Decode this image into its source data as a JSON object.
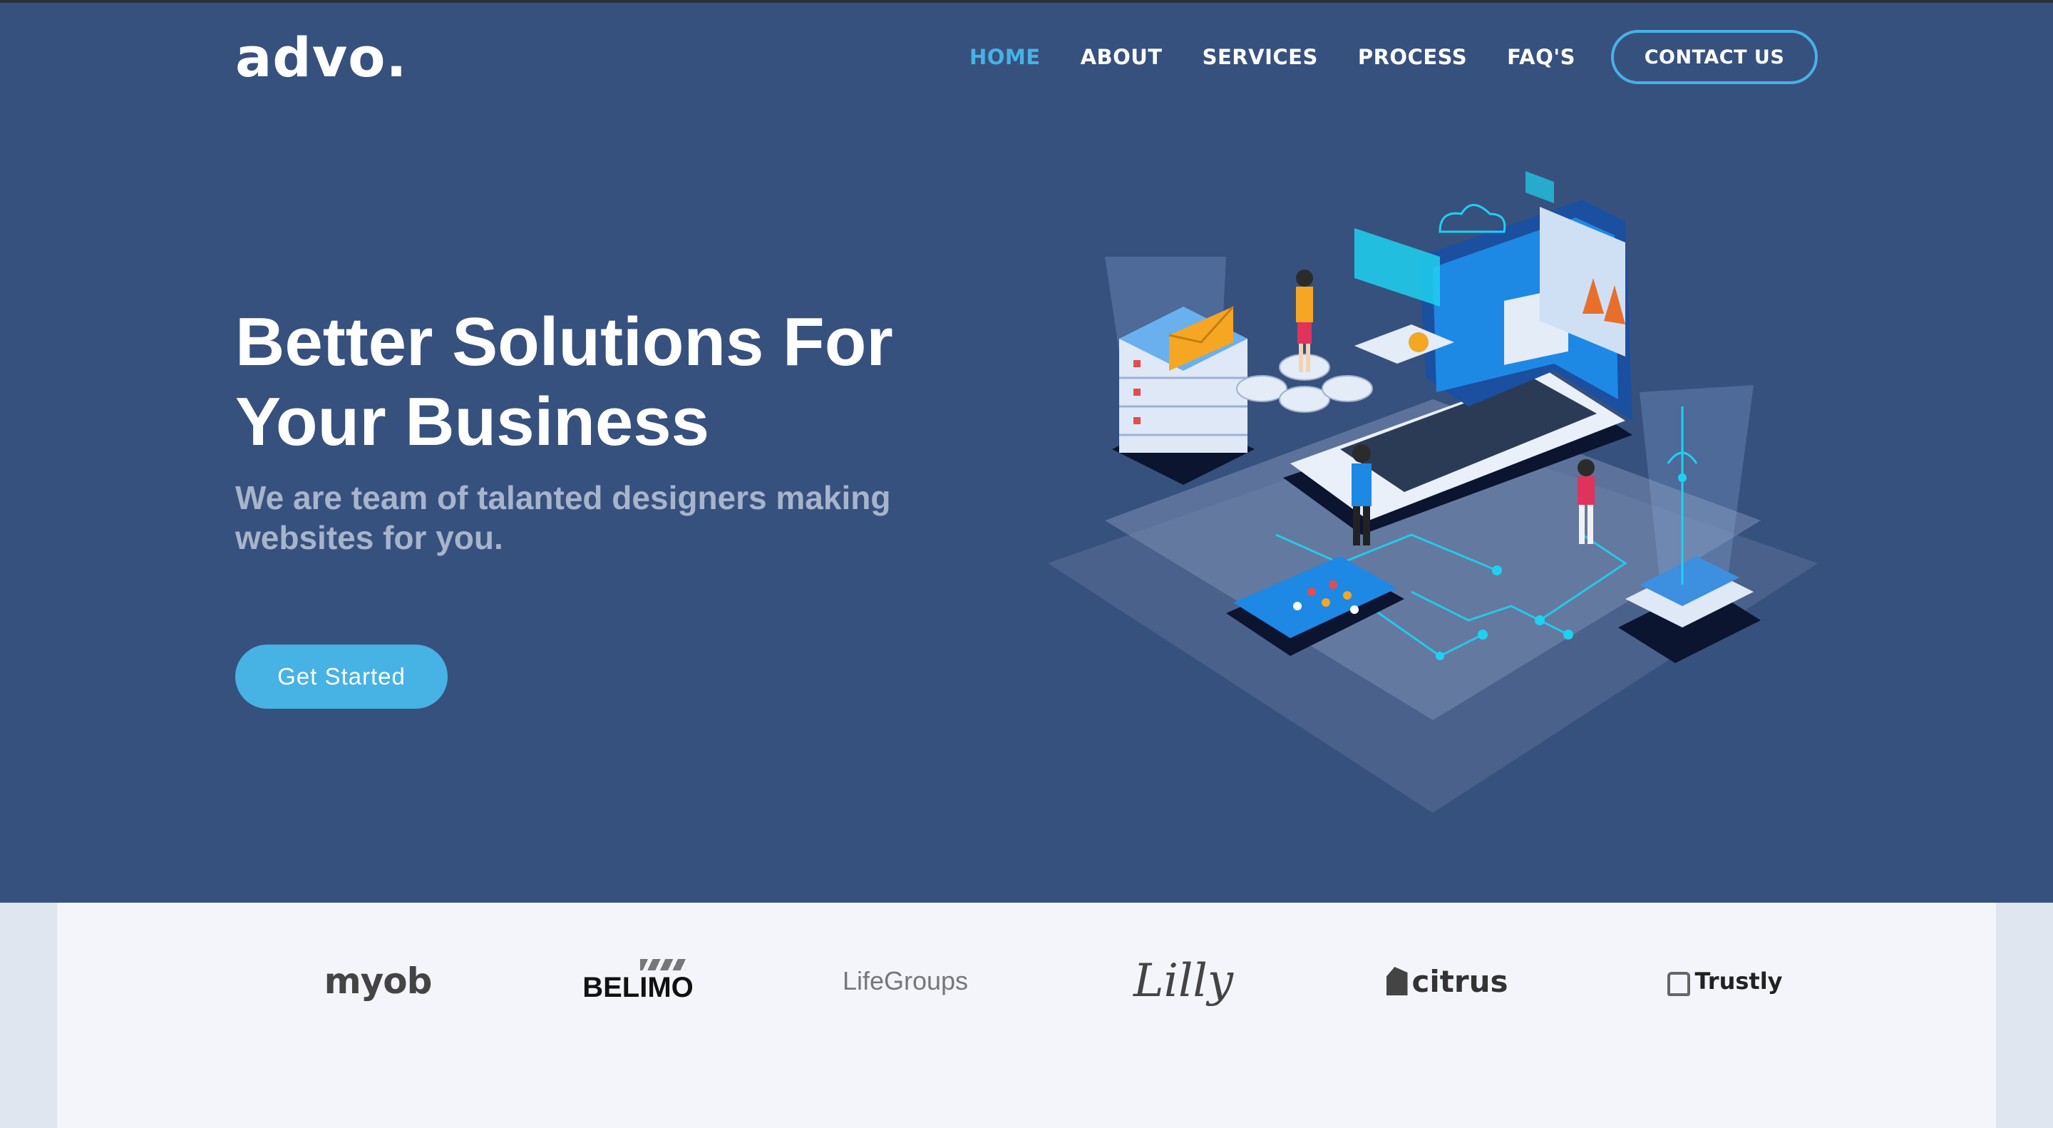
{
  "brand": {
    "logo": "advo."
  },
  "nav": {
    "items": [
      {
        "label": "HOME",
        "active": true
      },
      {
        "label": "ABOUT",
        "active": false
      },
      {
        "label": "SERVICES",
        "active": false
      },
      {
        "label": "PROCESS",
        "active": false
      },
      {
        "label": "FAQ'S",
        "active": false
      }
    ],
    "contact_label": "CONTACT US"
  },
  "hero": {
    "title_line1": "Better Solutions For",
    "title_line2": "Your Business",
    "subtitle": "We are team of talanted designers making websites for you.",
    "cta_label": "Get Started",
    "illustration": "isometric-tech-illustration"
  },
  "clients": {
    "logos": [
      {
        "name": "myob",
        "icon": "myob-logo"
      },
      {
        "name": "BELIMO",
        "icon": "belimo-logo"
      },
      {
        "name": "LifeGroups",
        "icon": "lifegroups-logo"
      },
      {
        "name": "Lilly",
        "icon": "lilly-logo"
      },
      {
        "name": "citrus",
        "icon": "citrus-logo"
      },
      {
        "name": "Trustly",
        "icon": "trustly-logo"
      }
    ]
  },
  "colors": {
    "hero_bg": "#37517e",
    "accent": "#47b2e4",
    "subtitle": "#a6b4cc",
    "clients_bg": "#f3f5fa",
    "page_bg": "#dfe6ef"
  }
}
